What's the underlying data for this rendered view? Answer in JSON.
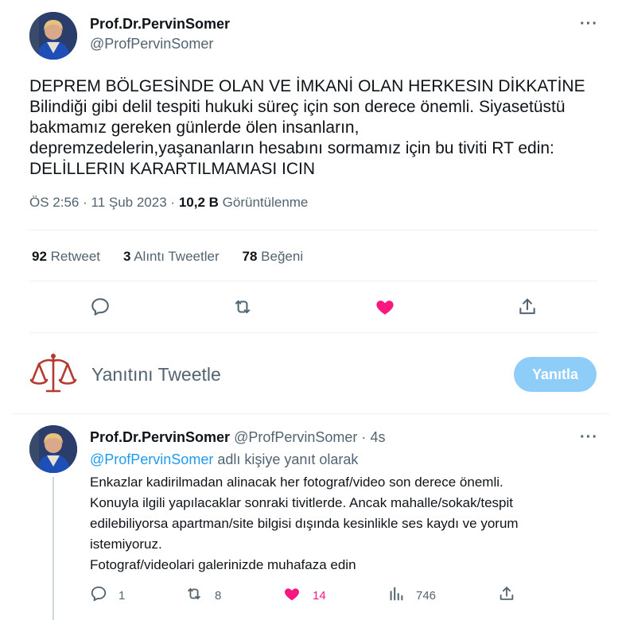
{
  "main_tweet": {
    "display_name": "Prof.Dr.PervinSomer",
    "handle": "@ProfPervinSomer",
    "more": "···",
    "text_lines": [
      "DEPREM BÖLGESİNDE OLAN VE İMKANİ OLAN HERKESIN DİKKATİNE",
      "Bilindiği gibi delil tespiti hukuki süreç için son derece önemli. Siyasetüstü",
      "bakmamız gereken günlerde ölen insanların,",
      "depremzedelerin,yaşananların hesabını sormamız için bu tiviti RT edin:",
      "DELİLLERIN KARARTILMAMASI ICIN"
    ],
    "time": "ÖS 2:56",
    "date": "11 Şub 2023",
    "separator": "·",
    "views": "10,2 B",
    "views_label": "Görüntülenme",
    "stats": {
      "retweets": "92",
      "retweets_label": "Retweet",
      "quotes": "3",
      "quotes_label": "Alıntı Tweetler",
      "likes": "78",
      "likes_label": "Beğeni"
    },
    "actions": [
      "reply-icon",
      "retweet-icon",
      "heart-icon",
      "share-icon"
    ],
    "like_color": "#f91880"
  },
  "composer": {
    "placeholder": "Yanıtını Tweetle",
    "button_label": "Yanıtla",
    "button_color": "#8ecdf8"
  },
  "reply_tweet": {
    "display_name": "Prof.Dr.PervinSomer",
    "handle": "@ProfPervinSomer",
    "dot": "·",
    "time": "4s",
    "more": "···",
    "replying_mention": "@ProfPervinSomer",
    "replying_suffix": " adlı kişiye yanıt olarak",
    "text_lines": [
      "Enkazlar kadirilmadan alinacak her fotograf/video son derece önemli.",
      "Konuyla ilgili yapılacaklar sonraki tivitlerde. Ancak mahalle/sokak/tespit",
      "edilebiliyorsa apartman/site bilgisi dışında kesinlikle ses kaydı ve yorum",
      "istemiyoruz.",
      "Fotograf/videolari galerinizde muhafaza edin"
    ],
    "counts": {
      "replies": "1",
      "retweets": "8",
      "likes": "14",
      "views": "746"
    }
  }
}
